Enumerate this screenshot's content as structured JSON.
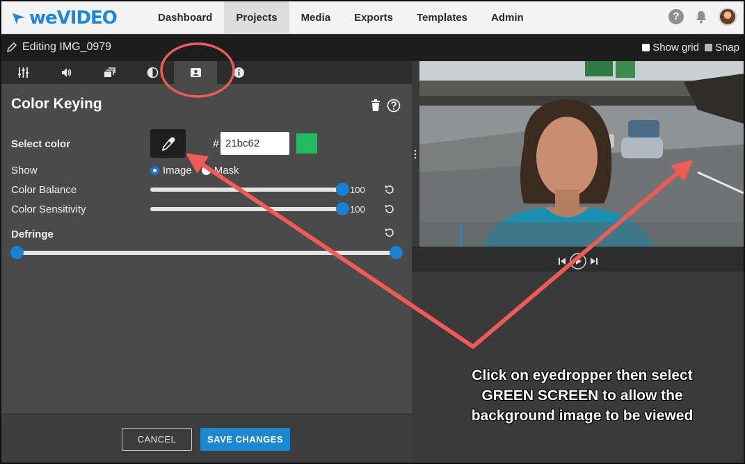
{
  "brand": {
    "logo_text": "weVIDEO",
    "color": "#1e88d6"
  },
  "nav": {
    "items": [
      {
        "label": "Dashboard",
        "active": false
      },
      {
        "label": "Projects",
        "active": true
      },
      {
        "label": "Media",
        "active": false
      },
      {
        "label": "Exports",
        "active": false
      },
      {
        "label": "Templates",
        "active": false
      },
      {
        "label": "Admin",
        "active": false
      }
    ],
    "help_glyph": "?"
  },
  "editbar": {
    "title": "Editing IMG_0979",
    "show_grid_label": "Show grid",
    "snap_label": "Snap"
  },
  "tabs": [
    "sliders-icon",
    "volume-icon",
    "layers-icon",
    "contrast-icon",
    "portrait-icon",
    "info-icon"
  ],
  "panel": {
    "title": "Color Keying",
    "select_color_label": "Select color",
    "hash": "#",
    "hex_value": "21bc62",
    "swatch_color": "#21bc62",
    "show_label": "Show",
    "show_options": {
      "image": "Image",
      "mask": "Mask",
      "selected": "Image"
    },
    "color_balance": {
      "label": "Color Balance",
      "value": "100",
      "fraction": 1.0
    },
    "color_sensitivity": {
      "label": "Color Sensitivity",
      "value": "100",
      "fraction": 1.0
    },
    "defringe": {
      "label": "Defringe",
      "low": 0.0,
      "high": 1.0
    }
  },
  "footer": {
    "cancel_label": "CANCEL",
    "save_label": "SAVE CHANGES",
    "accent": "#1b88d0"
  },
  "annotation": {
    "line1": "Click on eyedropper then select",
    "line2": "GREEN SCREEN to allow the",
    "line3": "background image to be viewed",
    "arrow_color": "#f05a57"
  }
}
